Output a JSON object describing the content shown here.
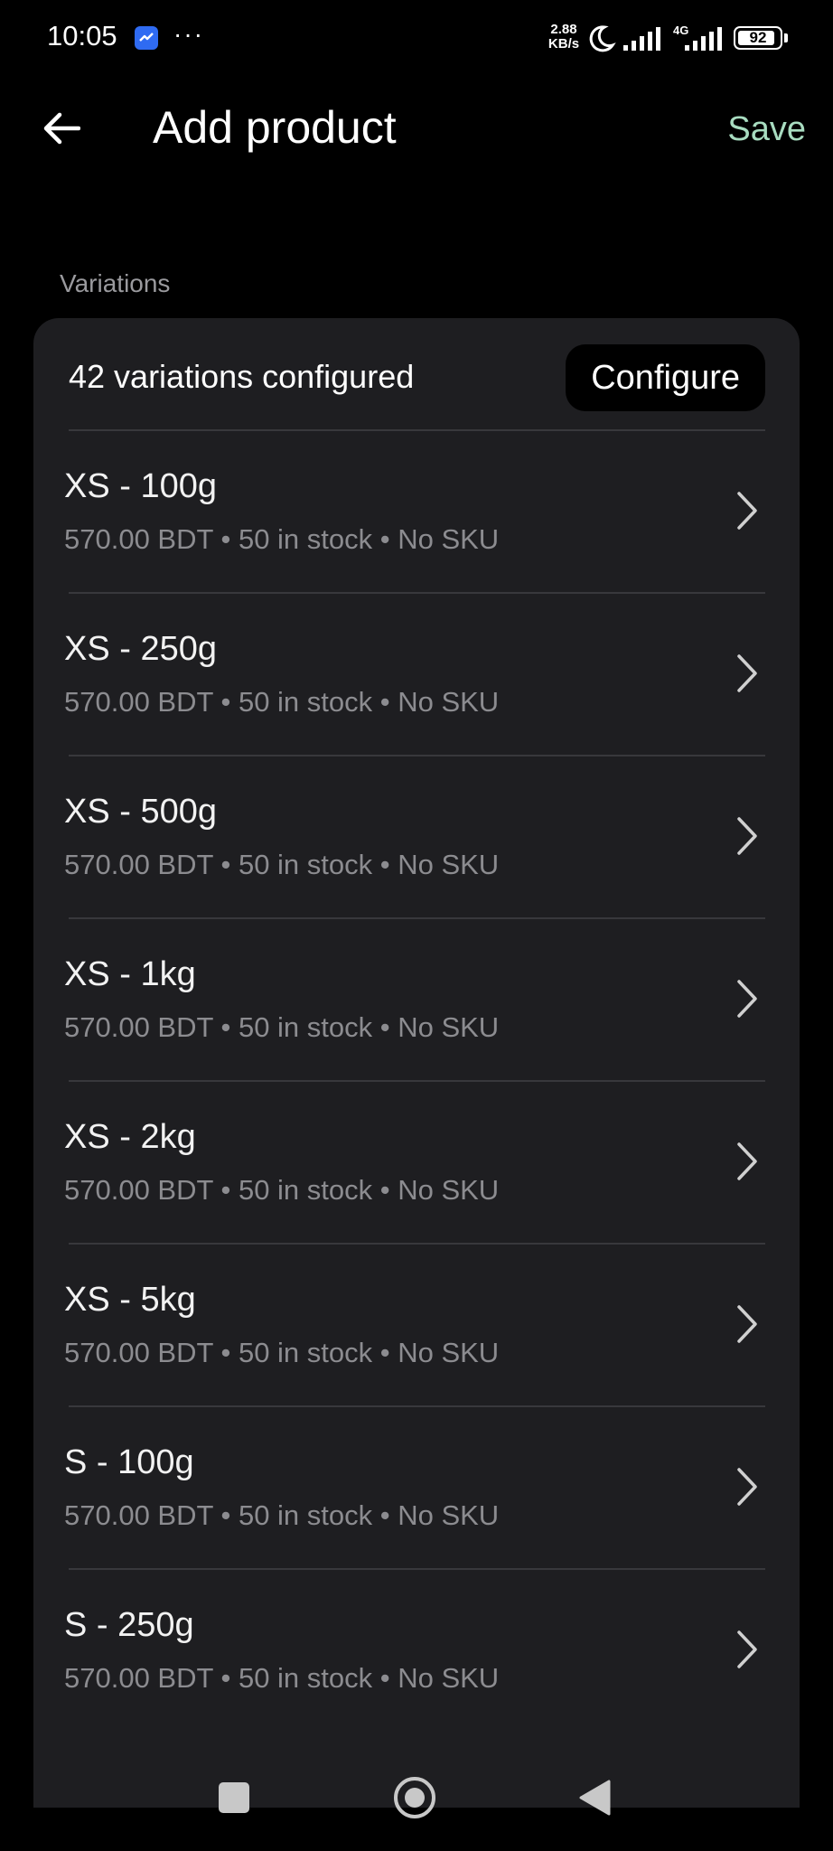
{
  "status_bar": {
    "time": "10:05",
    "more": "···",
    "net_speed_value": "2.88",
    "net_speed_unit": "KB/s",
    "network_type": "4G",
    "battery": "92",
    "battery_level": 0.92,
    "icons": [
      "messenger-icon",
      "moon-icon",
      "signal-icon",
      "battery-icon"
    ]
  },
  "app_bar": {
    "title": "Add product",
    "save_label": "Save",
    "save_color": "#a8dcc0",
    "back_icon": "arrow-left-icon"
  },
  "variations": {
    "section_label": "Variations",
    "summary": "42 variations configured",
    "configure_label": "Configure",
    "items": [
      {
        "title": "XS - 100g",
        "meta": "570.00 BDT • 50 in stock • No SKU"
      },
      {
        "title": "XS - 250g",
        "meta": "570.00 BDT • 50 in stock • No SKU"
      },
      {
        "title": "XS - 500g",
        "meta": "570.00 BDT • 50 in stock • No SKU"
      },
      {
        "title": "XS - 1kg",
        "meta": "570.00 BDT • 50 in stock • No SKU"
      },
      {
        "title": "XS - 2kg",
        "meta": "570.00 BDT • 50 in stock • No SKU"
      },
      {
        "title": "XS - 5kg",
        "meta": "570.00 BDT • 50 in stock • No SKU"
      },
      {
        "title": "S - 100g",
        "meta": "570.00 BDT • 50 in stock • No SKU"
      },
      {
        "title": "S - 250g",
        "meta": "570.00 BDT • 50 in stock • No SKU"
      }
    ]
  },
  "nav_bar": {
    "icons": [
      "home-square-icon",
      "recents-circle-icon",
      "back-triangle-icon"
    ]
  }
}
